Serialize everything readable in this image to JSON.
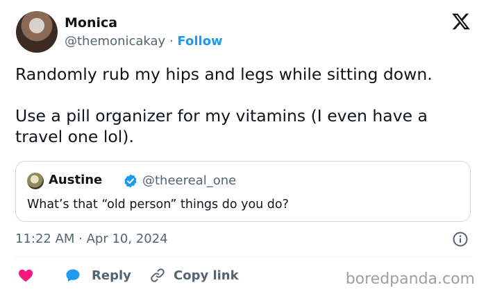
{
  "author": {
    "name": "Monica",
    "handle": "@themonicakay",
    "separator": "·",
    "follow_label": "Follow"
  },
  "tweet": {
    "paragraph_1": "Randomly rub my hips and legs while sitting down.",
    "paragraph_2": "Use a pill organizer for my vitamins (I even have a travel one lol)."
  },
  "quoted_tweet": {
    "name": "Austine",
    "handle": "@theereal_one",
    "text": "What’s that “old person” things do you do?"
  },
  "timestamp": "11:22 AM · Apr 10, 2024",
  "actions": {
    "reply_label": "Reply",
    "copy_link_label": "Copy link"
  },
  "watermark": "boredpanda.com",
  "colors": {
    "accent": "#1d9bf0",
    "like": "#f91880",
    "secondary_text": "#536471"
  },
  "icons": [
    "x-logo-icon",
    "verified-badge-icon",
    "info-icon",
    "heart-icon",
    "reply-bubble-icon",
    "link-icon"
  ]
}
